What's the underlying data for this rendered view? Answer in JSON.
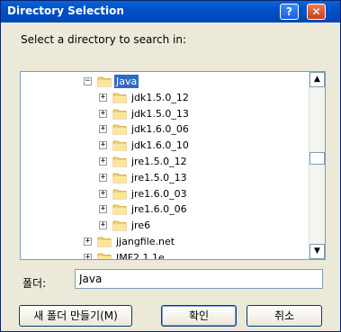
{
  "window": {
    "title": "Directory Selection",
    "help_label": "?",
    "close_label": "✕"
  },
  "prompt": "Select a directory to search in:",
  "tree": {
    "items": [
      {
        "label": "Java",
        "expander": "−",
        "selected": true
      },
      {
        "label": "jdk1.5.0_12",
        "expander": "+"
      },
      {
        "label": "jdk1.5.0_13",
        "expander": "+"
      },
      {
        "label": "jdk1.6.0_06",
        "expander": "+"
      },
      {
        "label": "jdk1.6.0_10",
        "expander": "+"
      },
      {
        "label": "jre1.5.0_12",
        "expander": "+"
      },
      {
        "label": "jre1.5.0_13",
        "expander": "+"
      },
      {
        "label": "jre1.6.0_03",
        "expander": "+"
      },
      {
        "label": "jre1.6.0_06",
        "expander": "+"
      },
      {
        "label": "jre6",
        "expander": "+"
      },
      {
        "label": "jjangfile.net",
        "expander": "+"
      },
      {
        "label": "JMF2.1.1e",
        "expander": "+"
      }
    ]
  },
  "scroll": {
    "up": "▲",
    "down": "▼"
  },
  "folder_field": {
    "label": "폴더:",
    "value": "Java"
  },
  "buttons": {
    "new_folder": "새 폴더 만들기(M)",
    "ok": "확인",
    "cancel": "취소"
  },
  "colors": {
    "selection": "#316ac5",
    "folder": "#f5d46a"
  }
}
